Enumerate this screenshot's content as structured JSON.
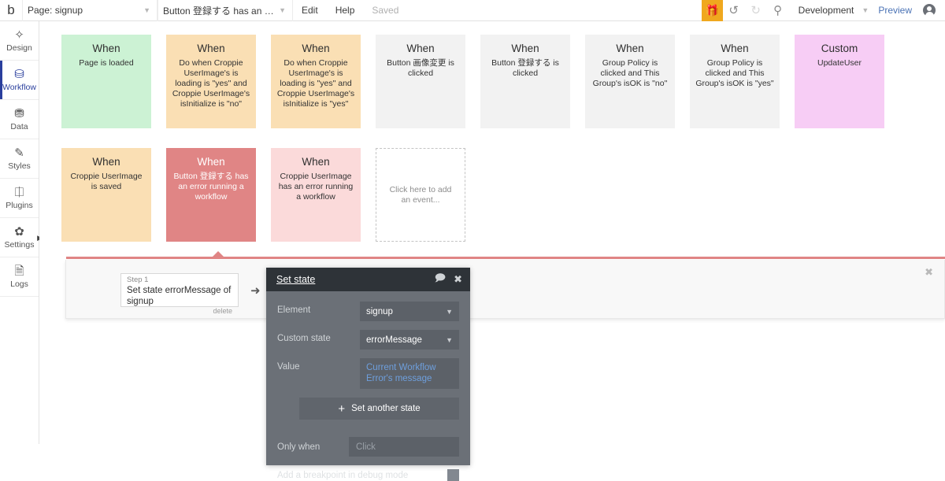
{
  "topbar": {
    "logo": "b",
    "page_select": "Page: signup",
    "workflow_select": "Button 登録する has an error ru...",
    "edit": "Edit",
    "help": "Help",
    "saved": "Saved",
    "gift_icon": "gift-icon",
    "undo_icon": "undo-icon",
    "redo_icon": "redo-icon",
    "search_icon": "search-icon",
    "version": "Development",
    "preview": "Preview",
    "accent": "#f0a81e",
    "link_color": "#4a72b5"
  },
  "sidebar": {
    "items": [
      {
        "label": "Design",
        "icon": "design-icon",
        "active": false
      },
      {
        "label": "Workflow",
        "icon": "workflow-icon",
        "active": true
      },
      {
        "label": "Data",
        "icon": "data-icon",
        "active": false
      },
      {
        "label": "Styles",
        "icon": "styles-icon",
        "active": false
      },
      {
        "label": "Plugins",
        "icon": "plugins-icon",
        "active": false
      },
      {
        "label": "Settings",
        "icon": "settings-icon",
        "active": false
      },
      {
        "label": "Logs",
        "icon": "logs-icon",
        "active": false
      }
    ],
    "active_color": "#2a3f9d"
  },
  "events": {
    "row1": [
      {
        "kind": "When",
        "text": "Page is loaded",
        "color": "green"
      },
      {
        "kind": "When",
        "text": "Do when Croppie UserImage's is loading is \"yes\" and Croppie UserImage's isInitialize is \"no\"",
        "color": "orange"
      },
      {
        "kind": "When",
        "text": "Do when Croppie UserImage's is loading is \"yes\" and Croppie UserImage's isInitialize is \"yes\"",
        "color": "orange"
      },
      {
        "kind": "When",
        "text": "Button 画像変更 is clicked",
        "color": "grey"
      },
      {
        "kind": "When",
        "text": "Button 登録する is clicked",
        "color": "grey"
      },
      {
        "kind": "When",
        "text": "Group Policy is clicked and This Group's isOK is \"no\"",
        "color": "grey"
      },
      {
        "kind": "When",
        "text": "Group Policy is clicked and This Group's isOK is \"yes\"",
        "color": "grey"
      },
      {
        "kind": "Custom",
        "text": "UpdateUser",
        "color": "pink"
      }
    ],
    "row2": [
      {
        "kind": "When",
        "text": "Croppie UserImage is saved",
        "color": "orange"
      },
      {
        "kind": "When",
        "text": "Button 登録する has an error running a workflow",
        "color": "selected"
      },
      {
        "kind": "When",
        "text": "Croppie UserImage has an error running a workflow",
        "color": "lightpink"
      }
    ],
    "add_placeholder": "Click here to add an event...",
    "selected_color": "#e08585"
  },
  "workflow_panel": {
    "close_icon": "close-icon",
    "step_label": "Step 1",
    "step_title": "Set state errorMessage of signup",
    "step_delete": "delete",
    "arrow_icon": "arrow-right-icon"
  },
  "dialog": {
    "title": "Set state",
    "comment_icon": "comment-icon",
    "close_icon": "close-icon",
    "fields": [
      {
        "label": "Element",
        "value": "signup",
        "type": "select"
      },
      {
        "label": "Custom state",
        "value": "errorMessage",
        "type": "select"
      }
    ],
    "value_label": "Value",
    "value_text": "Current Workflow Error's message",
    "value_link_color": "#6e9fdd",
    "add_button": "Set another state",
    "only_when_label": "Only when",
    "only_when_placeholder": "Click",
    "breakpoint_label": "Add a breakpoint in debug mode"
  }
}
